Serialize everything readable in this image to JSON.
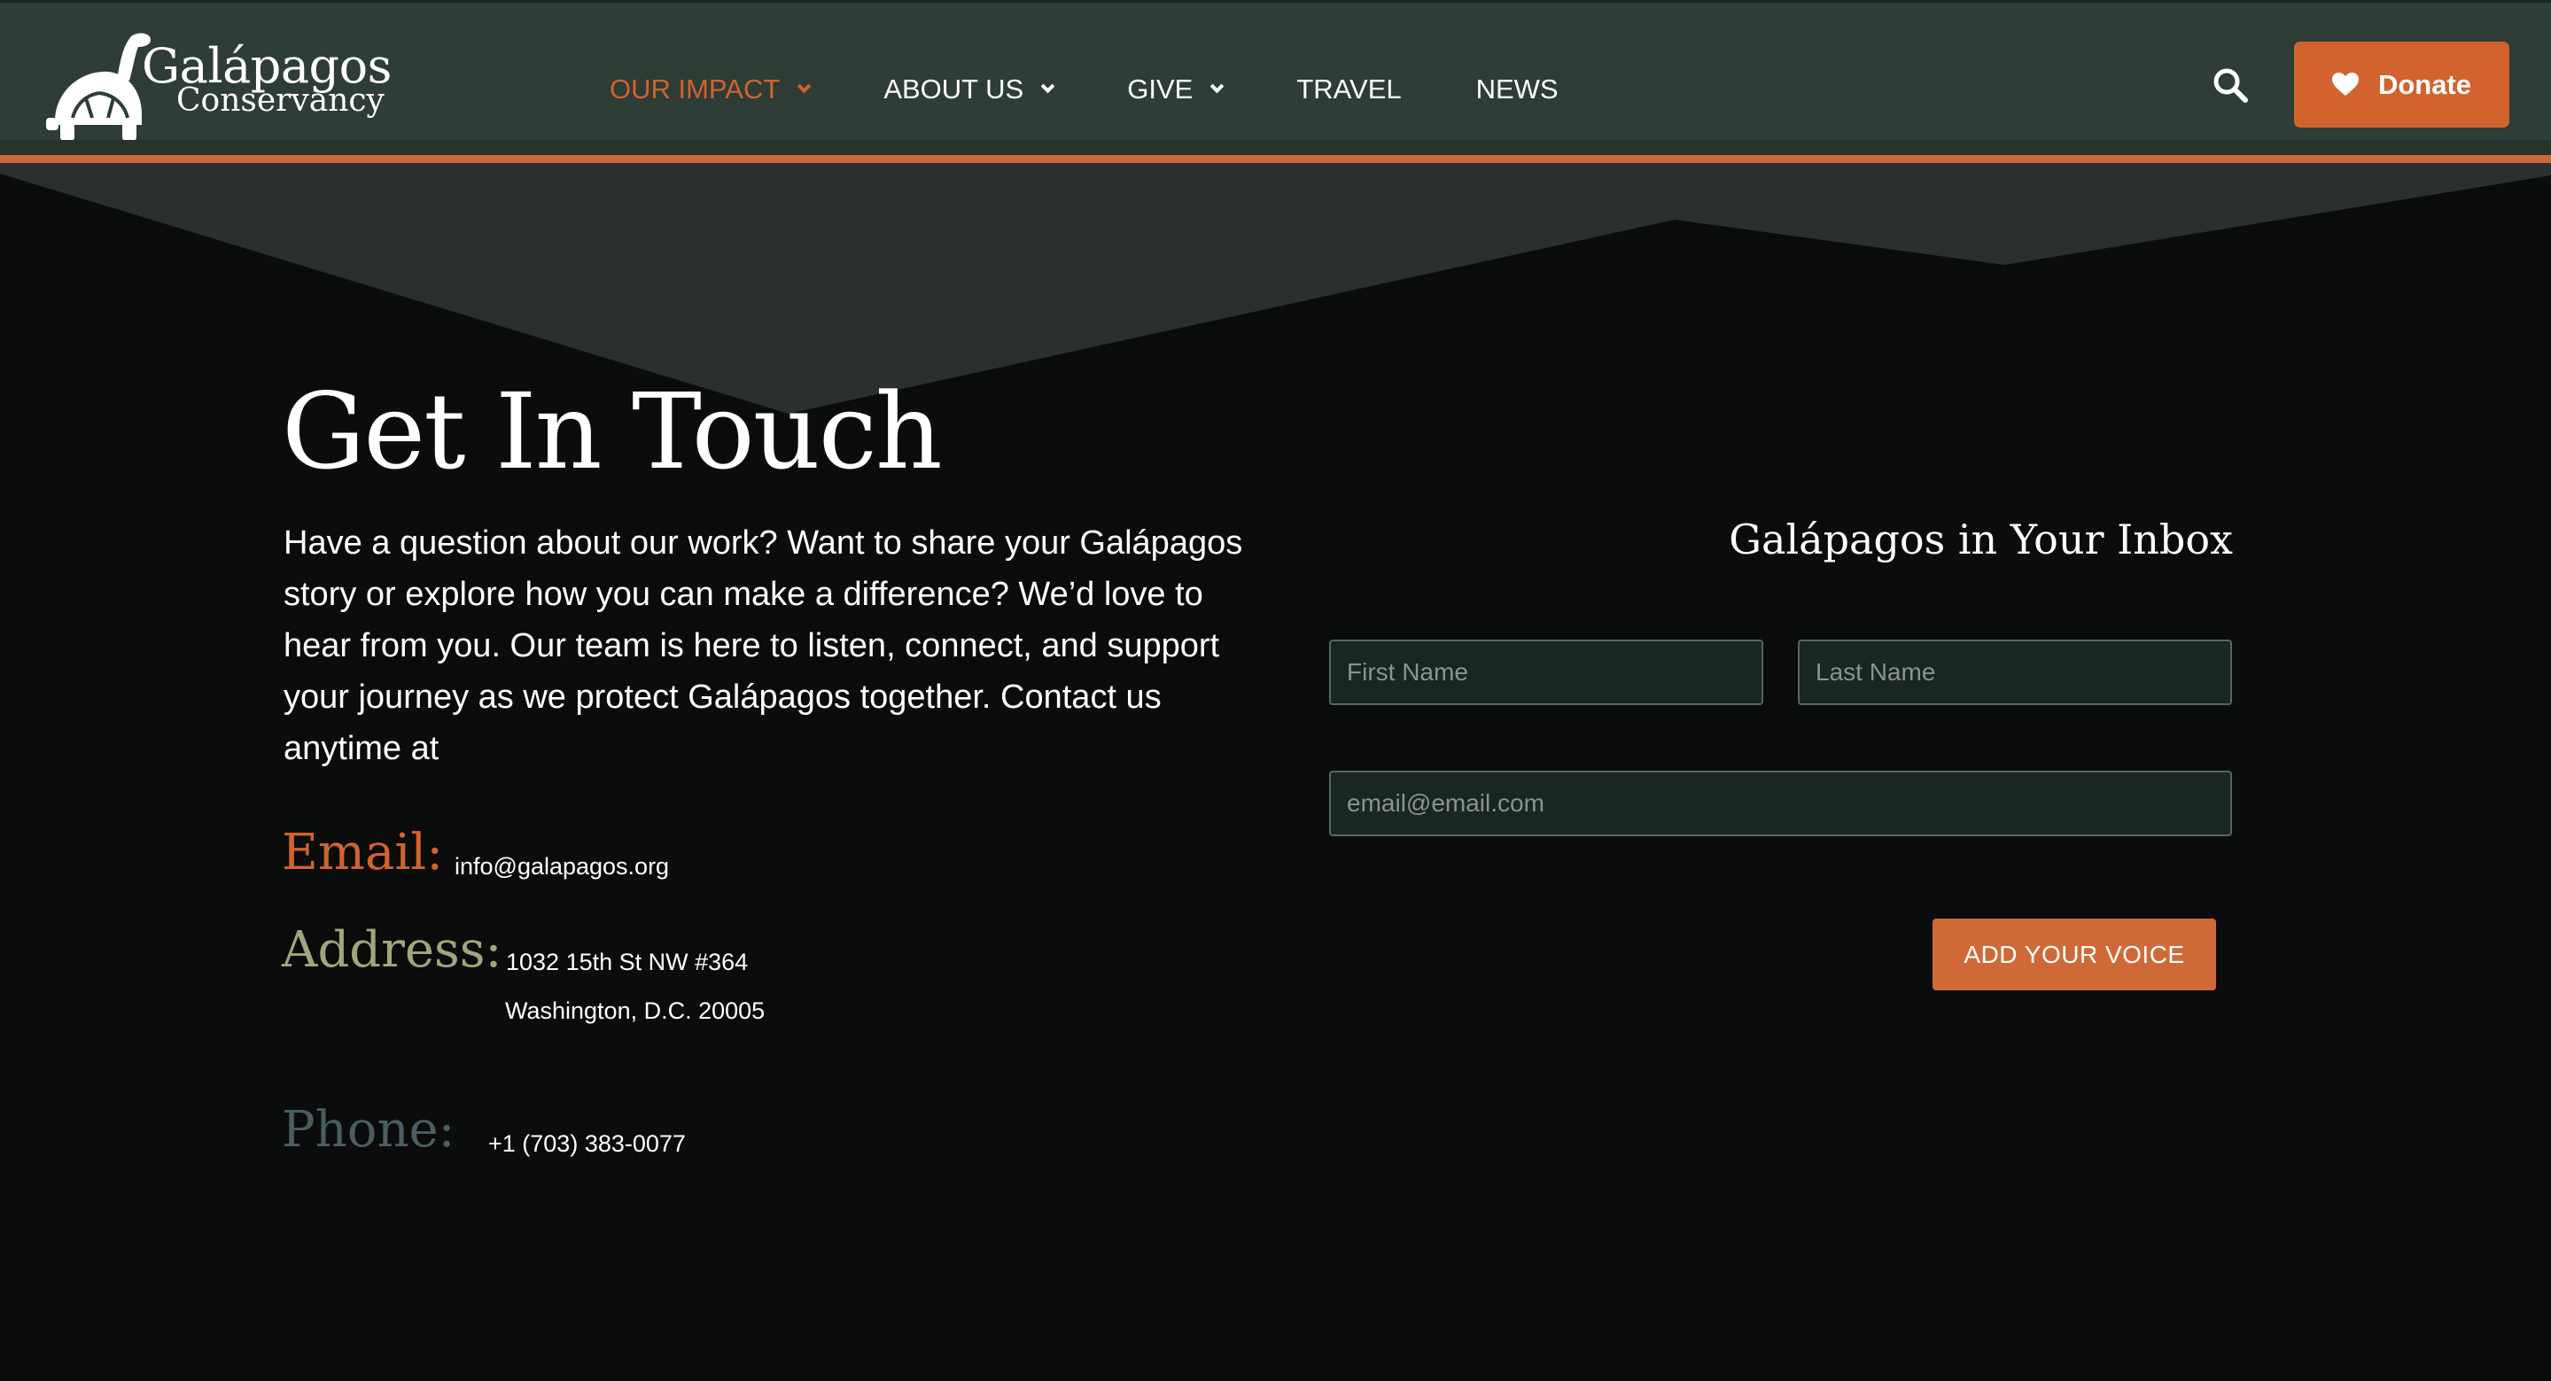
{
  "colors": {
    "accent": "#cf6a38",
    "header_bg": "#2e3d36",
    "page_bg": "#0a0d0c",
    "email_label": "#d2632f",
    "address_label": "#a3a67d",
    "phone_label": "#4b5d60"
  },
  "logo": {
    "line1": "Galápagos",
    "line2": "Conservancy",
    "icon": "tortoise-icon"
  },
  "nav": {
    "items": [
      {
        "label": "OUR IMPACT",
        "active": true,
        "dropdown": true
      },
      {
        "label": "ABOUT US",
        "active": false,
        "dropdown": true
      },
      {
        "label": "GIVE",
        "active": false,
        "dropdown": true
      },
      {
        "label": "TRAVEL",
        "active": false,
        "dropdown": false
      },
      {
        "label": "NEWS",
        "active": false,
        "dropdown": false
      }
    ]
  },
  "header": {
    "search_icon": "search-icon",
    "donate_label": "Donate",
    "donate_icon": "heart-icon"
  },
  "contact": {
    "title": "Get In Touch",
    "intro": "Have a question about our work? Want to share your Galápagos story or explore how you can make a difference? We’d love to hear from you. Our team is here to listen, connect, and support your journey as we protect Galápagos together. Contact us anytime at",
    "email_label": "Email:",
    "email_value": "info@galapagos.org",
    "address_label": "Address:",
    "address_line1": "1032 15th St NW #364",
    "address_line2": "Washington, D.C. 20005",
    "phone_label": "Phone:",
    "phone_value": "+1 (703) 383-0077"
  },
  "signup": {
    "title": "Galápagos in Your Inbox",
    "first_name_placeholder": "First Name",
    "last_name_placeholder": "Last Name",
    "email_placeholder": "email@email.com",
    "submit_label": "ADD YOUR VOICE"
  }
}
